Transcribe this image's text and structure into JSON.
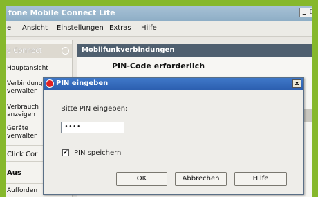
{
  "window": {
    "title": "fone Mobile Connect Lite"
  },
  "menu": [
    "Ansicht",
    "Einstellungen",
    "Extras",
    "Hilfe"
  ],
  "menu_cut_left": "e",
  "sidebar": {
    "header": "e Connect",
    "items": [
      {
        "label1": "Hauptansicht",
        "label2": ""
      },
      {
        "label1": "Verbindung",
        "label2": "verwalten"
      },
      {
        "label1": "Verbrauch",
        "label2": "anzeigen"
      },
      {
        "label1": "Geräte",
        "label2": "verwalten"
      },
      {
        "label1": "Click Cor",
        "label2": ""
      },
      {
        "label1": "Aus",
        "label2": ""
      },
      {
        "label1": "Aufforden",
        "label2": ""
      }
    ]
  },
  "main": {
    "section_header": "Mobilfunkverbindungen",
    "pin_required": "PIN-Code erforderlich"
  },
  "dialog": {
    "title": "PIN eingeben",
    "prompt": "Bitte PIN eingeben:",
    "pin_value": "••••",
    "save_pin_label": "PIN speichern",
    "save_pin_checked": true,
    "buttons": {
      "ok": "OK",
      "cancel": "Abbrechen",
      "help": "Hilfe"
    },
    "close": "x"
  }
}
